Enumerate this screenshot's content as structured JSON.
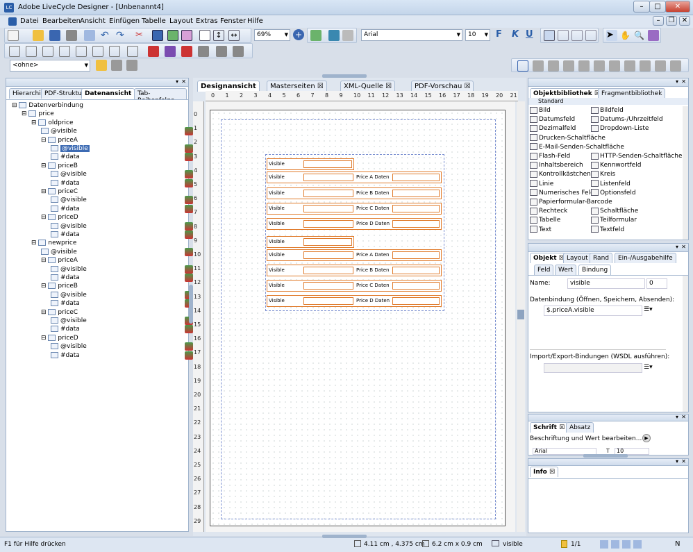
{
  "window": {
    "title": "Adobe LiveCycle Designer - [Unbenannt4]",
    "app_icon": "LC"
  },
  "menu": [
    "Datei",
    "Bearbeiten",
    "Ansicht",
    "Einfügen",
    "Tabelle",
    "Layout",
    "Extras",
    "Fenster",
    "Hilfe"
  ],
  "toolbar": {
    "zoom": "69%",
    "font": "Arial",
    "font_size": "10",
    "bold": "F",
    "italic": "K",
    "underline": "U",
    "master_combo": "<ohne>"
  },
  "left_panel": {
    "tabs": [
      "Hierarchie",
      "PDF-Struktur",
      "Datenansicht",
      "Tab-Reihenfolge"
    ],
    "active_tab": "Datenansicht",
    "tree": [
      {
        "label": "Datenverbindung",
        "depth": 0
      },
      {
        "label": "price",
        "depth": 1
      },
      {
        "label": "oldprice",
        "depth": 2
      },
      {
        "label": "@visible",
        "depth": 3
      },
      {
        "label": "priceA",
        "depth": 3
      },
      {
        "label": "@visible",
        "depth": 4,
        "selected": true
      },
      {
        "label": "#data",
        "depth": 4
      },
      {
        "label": "priceB",
        "depth": 3
      },
      {
        "label": "@visible",
        "depth": 4
      },
      {
        "label": "#data",
        "depth": 4
      },
      {
        "label": "priceC",
        "depth": 3
      },
      {
        "label": "@visible",
        "depth": 4
      },
      {
        "label": "#data",
        "depth": 4
      },
      {
        "label": "priceD",
        "depth": 3
      },
      {
        "label": "@visible",
        "depth": 4
      },
      {
        "label": "#data",
        "depth": 4
      },
      {
        "label": "newprice",
        "depth": 2
      },
      {
        "label": "@visible",
        "depth": 3
      },
      {
        "label": "priceA",
        "depth": 3
      },
      {
        "label": "@visible",
        "depth": 4
      },
      {
        "label": "#data",
        "depth": 4
      },
      {
        "label": "priceB",
        "depth": 3
      },
      {
        "label": "@visible",
        "depth": 4
      },
      {
        "label": "#data",
        "depth": 4
      },
      {
        "label": "priceC",
        "depth": 3
      },
      {
        "label": "@visible",
        "depth": 4
      },
      {
        "label": "#data",
        "depth": 4
      },
      {
        "label": "priceD",
        "depth": 3
      },
      {
        "label": "@visible",
        "depth": 4
      },
      {
        "label": "#data",
        "depth": 4
      }
    ]
  },
  "editor": {
    "tabs": [
      "Designansicht",
      "Masterseiten",
      "XML-Quelle",
      "PDF-Vorschau"
    ],
    "active_tab": "Designansicht",
    "ruler_h": [
      "0",
      "1",
      "2",
      "3",
      "4",
      "5",
      "6",
      "7",
      "8",
      "9",
      "10",
      "11",
      "12",
      "13",
      "14",
      "15",
      "16",
      "17",
      "18",
      "19",
      "20",
      "21"
    ],
    "ruler_v": [
      "0",
      "1",
      "2",
      "3",
      "4",
      "5",
      "6",
      "7",
      "8",
      "9",
      "10",
      "11",
      "12",
      "13",
      "14",
      "15",
      "16",
      "17",
      "18",
      "19",
      "20",
      "21",
      "22",
      "23",
      "24",
      "25",
      "26",
      "27",
      "28",
      "29"
    ],
    "form_rows": [
      {
        "label": "Visible",
        "price": ""
      },
      {
        "label": "Visible",
        "price": "Price A Daten"
      },
      {
        "label": "Visible",
        "price": "Price B Daten"
      },
      {
        "label": "Visible",
        "price": "Price C Daten"
      },
      {
        "label": "Visible",
        "price": "Price D Daten"
      },
      {
        "label": "Visible",
        "price": ""
      },
      {
        "label": "Visible",
        "price": "Price A Daten"
      },
      {
        "label": "Visible",
        "price": "Price B Daten"
      },
      {
        "label": "Visible",
        "price": "Price C Daten"
      },
      {
        "label": "Visible",
        "price": "Price D Daten"
      }
    ]
  },
  "library": {
    "tabs": [
      "Objektbibliothek",
      "Fragmentbibliothek"
    ],
    "section": "Standard",
    "items_left": [
      "Bild",
      "Datumsfeld",
      "Dezimalfeld",
      "Drucken-Schaltfläche",
      "E-Mail-Senden-Schaltfläche",
      "Flash-Feld",
      "Inhaltsbereich",
      "Kontrollkästchen",
      "Linie",
      "Numerisches Feld",
      "Papierformular-Barcode",
      "Rechteck",
      "Tabelle",
      "Text"
    ],
    "items_right": [
      "Bildfeld",
      "Datums-/Uhrzeitfeld",
      "Dropdown-Liste",
      "",
      "",
      "HTTP-Senden-Schaltfläche",
      "Kennwortfeld",
      "Kreis",
      "Listenfeld",
      "Optionsfeld",
      "",
      "Schaltfläche",
      "Teilformular",
      "Textfeld"
    ]
  },
  "object_panel": {
    "tabs": [
      "Objekt",
      "Layout",
      "Rand",
      "Ein-/Ausgabehilfe"
    ],
    "subtabs": [
      "Feld",
      "Wert",
      "Bindung"
    ],
    "name_label": "Name:",
    "name_value": "visible",
    "name_index": "0",
    "binding_label": "Datenbindung (Öffnen, Speichern, Absenden):",
    "binding_value": "$.priceA.visible",
    "import_label": "Import/Export-Bindungen (WSDL ausführen):"
  },
  "font_panel": {
    "tabs": [
      "Schrift",
      "Absatz"
    ],
    "text": "Beschriftung und Wert bearbeiten...",
    "font": "Arial",
    "size": "10"
  },
  "info_panel": {
    "title": "Info"
  },
  "status": {
    "help": "F1 für Hilfe drücken",
    "position": "4.11 cm , 4.375 cm",
    "size": "6.2 cm x 0.9 cm",
    "object": "visible",
    "page": "1/1"
  }
}
